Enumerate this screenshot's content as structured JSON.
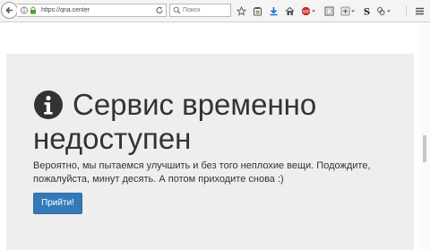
{
  "browser": {
    "url": "https://qna.center",
    "search_placeholder": "Поиск"
  },
  "page": {
    "title": "Сервис временно недоступен",
    "description": "Вероятно, мы пытаемся улучшить и без того неплохие вещи. Подождите, пожалуйста, минут десять. А потом приходите снова :)",
    "button_label": "Прийти!"
  },
  "icons": {
    "heading_icon": "info-circle-icon",
    "button_color": "#337ab7"
  }
}
